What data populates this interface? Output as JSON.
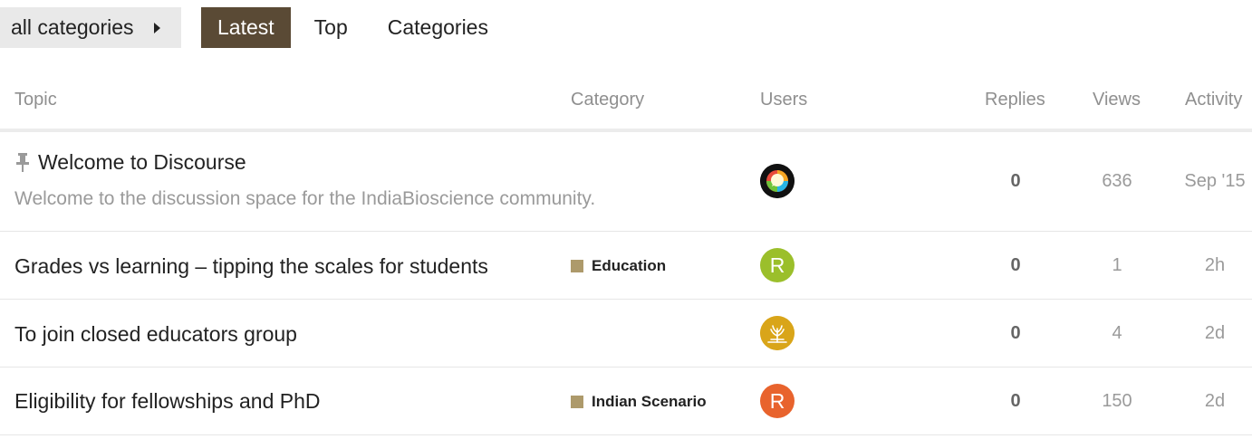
{
  "nav": {
    "category_dropdown": "all categories",
    "tabs": [
      {
        "label": "Latest",
        "active": true
      },
      {
        "label": "Top",
        "active": false
      },
      {
        "label": "Categories",
        "active": false
      }
    ]
  },
  "columns": {
    "topic": "Topic",
    "category": "Category",
    "users": "Users",
    "replies": "Replies",
    "views": "Views",
    "activity": "Activity"
  },
  "topics": [
    {
      "title": "Welcome to Discourse",
      "pinned": true,
      "excerpt": "Welcome to the discussion space for the IndiaBioscience community.",
      "category": "",
      "user_avatar": "discourse-logo-avatar",
      "replies": "0",
      "views": "636",
      "activity": "Sep '15"
    },
    {
      "title": "Grades vs learning – tipping the scales for students",
      "category": "Education",
      "category_color": "#ad9a6b",
      "user_avatar": "letter",
      "avatar_letter": "R",
      "avatar_color": "#9bbf2b",
      "replies": "0",
      "views": "1",
      "activity": "2h"
    },
    {
      "title": "To join closed educators group",
      "category": "",
      "user_avatar": "tree-logo-avatar",
      "avatar_color": "#d9a519",
      "replies": "0",
      "views": "4",
      "activity": "2d"
    },
    {
      "title": "Eligibility for fellowships and PhD",
      "category": "Indian Scenario",
      "category_color": "#ad9a6b",
      "user_avatar": "letter",
      "avatar_letter": "R",
      "avatar_color": "#e8632d",
      "replies": "0",
      "views": "150",
      "activity": "2d"
    }
  ]
}
